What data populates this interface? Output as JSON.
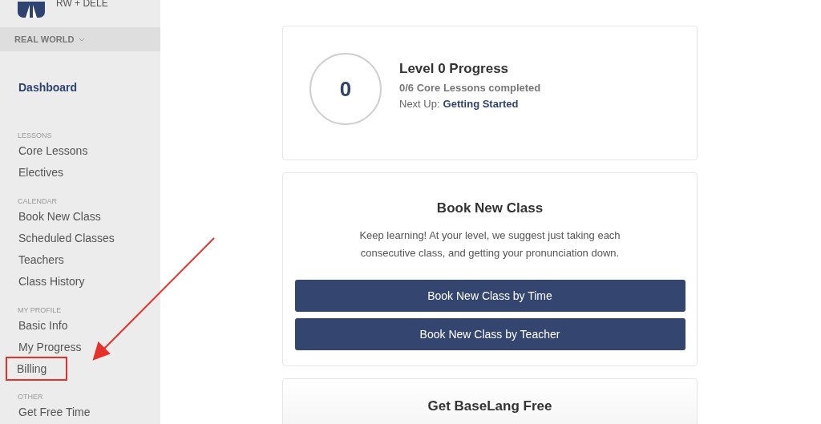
{
  "sidebar": {
    "brand": "RW + DELE",
    "account": "REAL WORLD",
    "items": [
      {
        "kind": "link",
        "label": "Dashboard",
        "selected": true,
        "highlighted": false
      },
      {
        "kind": "heading",
        "label": "LESSONS"
      },
      {
        "kind": "link",
        "label": "Core Lessons",
        "selected": false,
        "highlighted": false
      },
      {
        "kind": "link",
        "label": "Electives",
        "selected": false,
        "highlighted": false
      },
      {
        "kind": "heading",
        "label": "CALENDAR"
      },
      {
        "kind": "link",
        "label": "Book New Class",
        "selected": false,
        "highlighted": false
      },
      {
        "kind": "link",
        "label": "Scheduled Classes",
        "selected": false,
        "highlighted": false
      },
      {
        "kind": "link",
        "label": "Teachers",
        "selected": false,
        "highlighted": false
      },
      {
        "kind": "link",
        "label": "Class History",
        "selected": false,
        "highlighted": false
      },
      {
        "kind": "heading",
        "label": "MY PROFILE"
      },
      {
        "kind": "link",
        "label": "Basic Info",
        "selected": false,
        "highlighted": false
      },
      {
        "kind": "link",
        "label": "My Progress",
        "selected": false,
        "highlighted": false
      },
      {
        "kind": "link",
        "label": "Billing",
        "selected": false,
        "highlighted": true
      },
      {
        "kind": "heading",
        "label": "OTHER"
      },
      {
        "kind": "link",
        "label": "Get Free Time",
        "selected": false,
        "highlighted": false
      }
    ]
  },
  "progress": {
    "level": "0",
    "title": "Level 0 Progress",
    "completed": "0/6 Core Lessons completed",
    "next_label": "Next Up:",
    "next_link": "Getting Started"
  },
  "book": {
    "title": "Book New Class",
    "text": "Keep learning! At your level, we suggest just taking each consecutive class, and getting your pronunciation down.",
    "buttons": [
      "Book New Class by Time",
      "Book New Class by Teacher"
    ]
  },
  "free": {
    "title": "Get BaseLang Free"
  }
}
